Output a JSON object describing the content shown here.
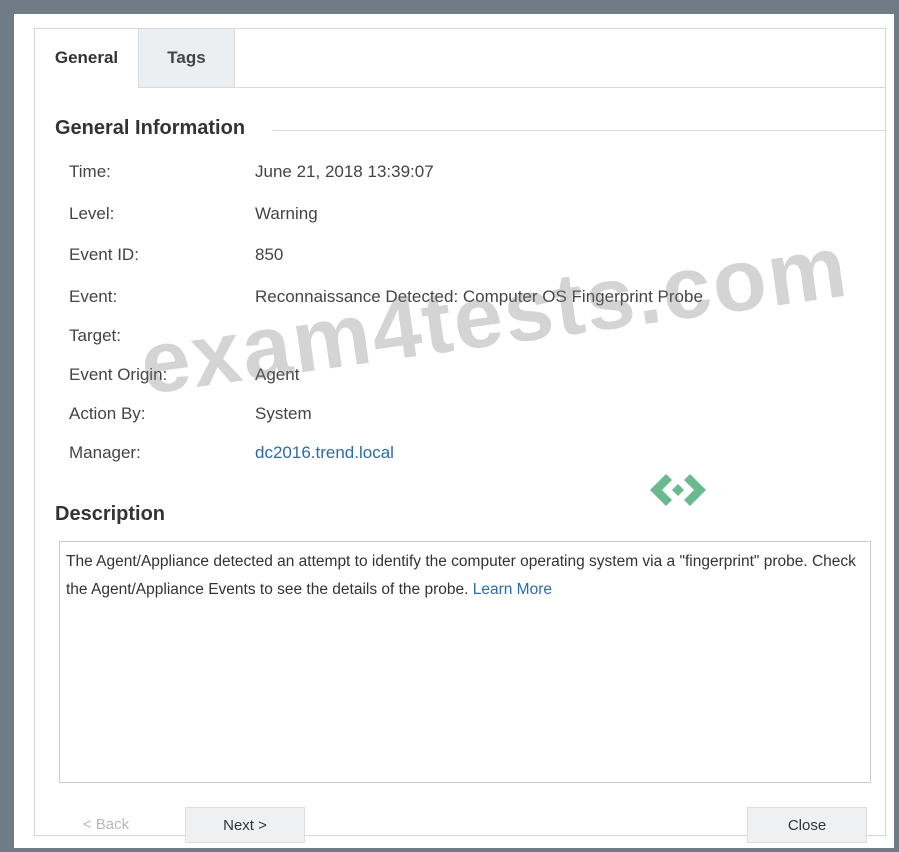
{
  "tabs": [
    {
      "label": "General",
      "active": true
    },
    {
      "label": "Tags",
      "active": false
    }
  ],
  "general_info": {
    "title": "General Information",
    "rows": [
      {
        "label": "Time:",
        "value": "June 21, 2018 13:39:07"
      },
      {
        "label": "Level:",
        "value": "Warning"
      },
      {
        "label": "Event ID:",
        "value": "850"
      },
      {
        "label": "Event:",
        "value": "Reconnaissance Detected: Computer OS Fingerprint Probe"
      },
      {
        "label": "Target:",
        "value": ""
      },
      {
        "label": "Event Origin:",
        "value": "Agent"
      },
      {
        "label": "Action By:",
        "value": "System"
      },
      {
        "label": "Manager:",
        "value": "dc2016.trend.local"
      }
    ]
  },
  "description": {
    "title": "Description",
    "text": "The Agent/Appliance detected an attempt to identify the computer operating system via a \"fingerprint\" probe. Check the Agent/Appliance Events to see the details of the probe.",
    "link": "Learn More"
  },
  "buttons": {
    "back": "< Back",
    "next": "Next >",
    "close": "Close"
  },
  "watermark": {
    "text": "exam4tests.com"
  },
  "colors": {
    "link": "#2d6aa8",
    "outer_background": "#6f7b86",
    "watermark_logo": "#3aa36a"
  }
}
